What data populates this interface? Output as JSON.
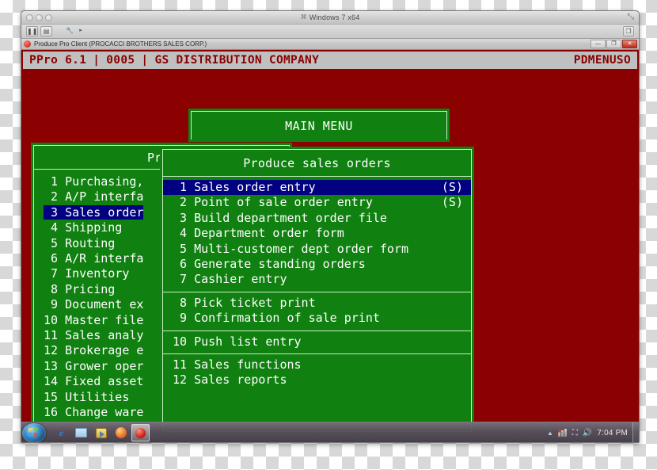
{
  "host_window": {
    "title": "Windows 7 x64",
    "title_glyph": "⌘",
    "traffic_lights": [
      "close",
      "minimize",
      "zoom"
    ],
    "toolbar": {
      "pause_label": "❚❚",
      "snapshot_label": "▤",
      "tools_label": "🔧",
      "tools_caret": "▸",
      "window_mode_label": "❐"
    },
    "fullscreen_label": "⤢"
  },
  "app_window": {
    "title": "Produce Pro Client (PROCACCI BROTHERS SALES CORP.)",
    "controls": {
      "minimize": "—",
      "maximize": "❐",
      "close": "✕"
    }
  },
  "banner": {
    "product": "PPro 6.1",
    "separator": "|",
    "session": "0005",
    "company": "GS DISTRIBUTION COMPANY",
    "program_id": "PDMENUSO"
  },
  "main_menu": {
    "title": "MAIN MENU"
  },
  "left_menu": {
    "title": "Prod",
    "items": [
      {
        "num": "1",
        "label": "Purchasing,",
        "selected": false
      },
      {
        "num": "2",
        "label": "A/P interfa",
        "selected": false
      },
      {
        "num": "3",
        "label": "Sales order",
        "selected": true
      },
      {
        "num": "4",
        "label": "Shipping",
        "selected": false
      },
      {
        "num": "5",
        "label": "Routing",
        "selected": false
      },
      {
        "num": "6",
        "label": "A/R interfa",
        "selected": false
      },
      {
        "num": "7",
        "label": "Inventory",
        "selected": false
      },
      {
        "num": "8",
        "label": "Pricing",
        "selected": false
      },
      {
        "num": "9",
        "label": "Document ex",
        "selected": false
      },
      {
        "num": "10",
        "label": "Master file",
        "selected": false
      },
      {
        "num": "11",
        "label": "Sales analy",
        "selected": false
      },
      {
        "num": "12",
        "label": "Brokerage e",
        "selected": false
      },
      {
        "num": "13",
        "label": "Grower oper",
        "selected": false
      },
      {
        "num": "14",
        "label": "Fixed asset",
        "selected": false
      },
      {
        "num": "15",
        "label": "Utilities",
        "selected": false
      },
      {
        "num": "16",
        "label": "Change ware",
        "selected": false
      }
    ]
  },
  "right_menu": {
    "title": "Produce sales orders",
    "groups": [
      {
        "items": [
          {
            "num": "1",
            "label": "Sales order entry",
            "tag": "(S)",
            "selected": true
          },
          {
            "num": "2",
            "label": "Point of sale order entry",
            "tag": "(S)",
            "selected": false
          },
          {
            "num": "3",
            "label": "Build department order file",
            "tag": "",
            "selected": false
          },
          {
            "num": "4",
            "label": "Department order form",
            "tag": "",
            "selected": false
          },
          {
            "num": "5",
            "label": "Multi-customer dept order form",
            "tag": "",
            "selected": false
          },
          {
            "num": "6",
            "label": "Generate standing orders",
            "tag": "",
            "selected": false
          },
          {
            "num": "7",
            "label": "Cashier entry",
            "tag": "",
            "selected": false
          }
        ]
      },
      {
        "items": [
          {
            "num": "8",
            "label": "Pick ticket print",
            "tag": "",
            "selected": false
          },
          {
            "num": "9",
            "label": "Confirmation of sale print",
            "tag": "",
            "selected": false
          }
        ]
      },
      {
        "items": [
          {
            "num": "10",
            "label": "Push list entry",
            "tag": "",
            "selected": false
          }
        ]
      },
      {
        "items": [
          {
            "num": "11",
            "label": "Sales functions",
            "tag": "",
            "selected": false
          },
          {
            "num": "12",
            "label": "Sales reports",
            "tag": "",
            "selected": false
          }
        ]
      }
    ]
  },
  "taskbar": {
    "start_label": "Start",
    "quicklaunch": [
      {
        "icon": "internet-explorer-icon",
        "label": "e"
      },
      {
        "icon": "windows-explorer-icon",
        "label": ""
      },
      {
        "icon": "media-player-icon",
        "label": ""
      },
      {
        "icon": "firefox-icon",
        "label": ""
      },
      {
        "icon": "produce-pro-icon",
        "label": "",
        "active": true
      }
    ],
    "tray": {
      "show_hidden_label": "▲",
      "network_label": "network-icon",
      "action_center_label": "⛶",
      "volume_label": "🔊",
      "clock": "7:04 PM"
    }
  },
  "colors": {
    "terminal_bg": "#8b0000",
    "panel_green": "#108010",
    "panel_border": "#c6f0c6",
    "highlight": "#000080",
    "banner_bg": "#c0c0c0",
    "banner_fg": "#8b0000",
    "text": "#ffffff"
  }
}
